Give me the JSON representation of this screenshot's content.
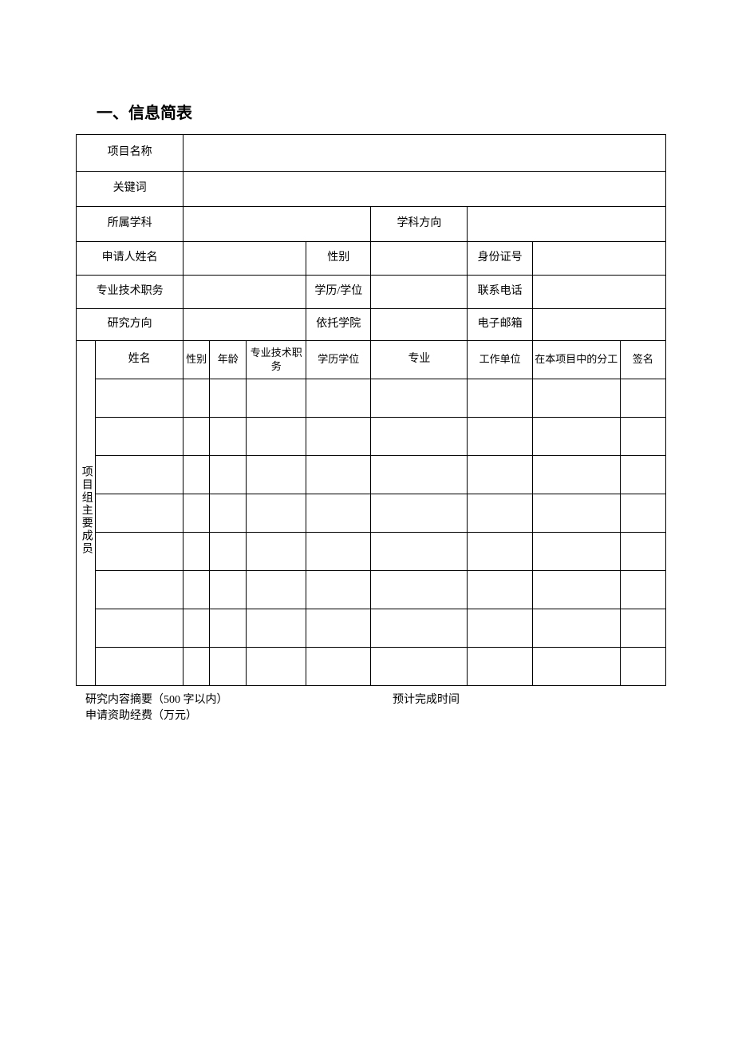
{
  "title": "一、信息简表",
  "labels": {
    "project_name": "项目名称",
    "keywords": "关键词",
    "subject": "所属学科",
    "subject_direction": "学科方向",
    "applicant_name": "申请人姓名",
    "gender": "性别",
    "id_number": "身份证号",
    "professional_title": "专业技术职务",
    "education_degree": "学历/学位",
    "phone": "联系电话",
    "research_direction": "研究方向",
    "host_college": "依托学院",
    "email": "电子邮箱",
    "team_label": "项目组主要成员",
    "m_name": "姓名",
    "m_gender": "性别",
    "m_age": "年龄",
    "m_title": "专业技术职务",
    "m_edu": "学历学位",
    "m_major": "专业",
    "m_unit": "工作单位",
    "m_role": "在本项目中的分工",
    "m_sign": "签名"
  },
  "values": {
    "project_name": "",
    "keywords": "",
    "subject": "",
    "subject_direction": "",
    "applicant_name": "",
    "gender": "",
    "id_number": "",
    "professional_title": "",
    "education_degree": "",
    "phone": "",
    "research_direction": "",
    "host_college": "",
    "email": ""
  },
  "footer": {
    "abstract": "研究内容摘要（500 字以内）",
    "expected_time": "预计完成时间",
    "funding": "申请资助经费（万元）"
  }
}
